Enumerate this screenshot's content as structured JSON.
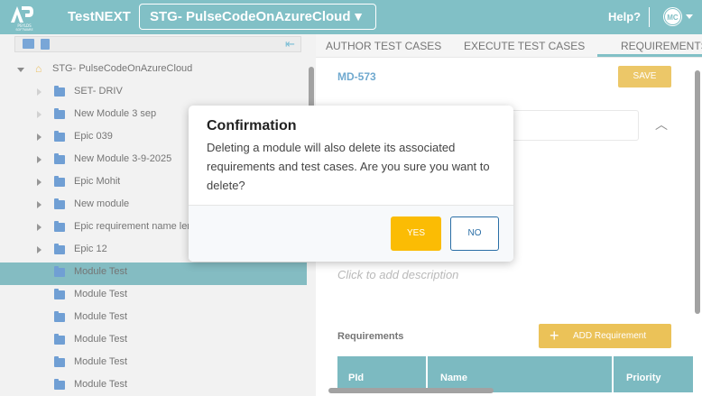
{
  "header": {
    "app_title": "TestNEXT",
    "project": "STG- PulseCodeOnAzureCloud",
    "project_caret": "▼",
    "help": "Help?",
    "avatar": "MC",
    "logo_text": "PSYLDS\nSOFTWARE"
  },
  "tree": {
    "root": "STG- PulseCodeOnAzureCloud",
    "items": [
      {
        "label": "SET- DRIV"
      },
      {
        "label": "New Module 3 sep"
      },
      {
        "label": "Epic 039"
      },
      {
        "label": "New Module 3-9-2025"
      },
      {
        "label": "Epic Mohit"
      },
      {
        "label": "New module"
      },
      {
        "label": "Epic requirement name ler"
      },
      {
        "label": "Epic 12"
      },
      {
        "label": "Module Test"
      },
      {
        "label": "Module Test"
      },
      {
        "label": "Module Test"
      },
      {
        "label": "Module Test"
      },
      {
        "label": "Module Test"
      },
      {
        "label": "Module Test"
      }
    ]
  },
  "tabs": [
    {
      "label": "AUTHOR TEST CASES"
    },
    {
      "label": "EXECUTE TEST CASES"
    },
    {
      "label": "REQUIREMENTS"
    }
  ],
  "detail": {
    "req_id": "MD-573",
    "save": "SAVE",
    "description_placeholder": "Click to add description",
    "requirements_title": "Requirements",
    "add_requirement": "ADD Requirement",
    "columns": [
      "PId",
      "Name",
      "Priority"
    ]
  },
  "modal": {
    "title": "Confirmation",
    "message": "Deleting a module will also delete its associated requirements and test cases. Are you sure you want to delete?",
    "yes": "YES",
    "no": "NO"
  },
  "colors": {
    "header": "#46a2ab",
    "accent": "#fbbc04",
    "folder": "#2d72c0",
    "selected_row": "#4b9ca5"
  }
}
